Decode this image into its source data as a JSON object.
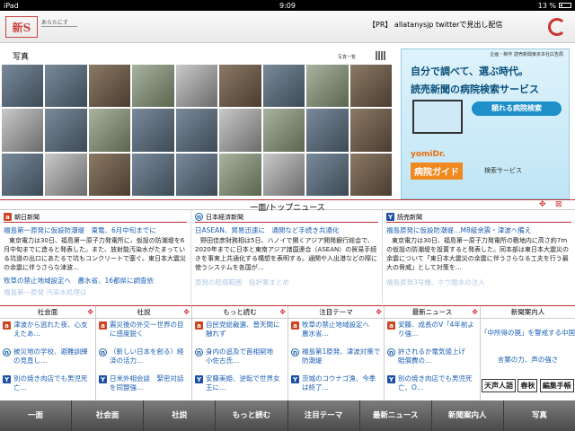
{
  "status": {
    "device": "iPad",
    "time": "9:09",
    "battery": "13 %"
  },
  "header": {
    "logo": "新S",
    "tagline": "あらたにす",
    "pr_text": "【PR】 allatanysjp twitterで見出し配信"
  },
  "photos": {
    "title": "写真",
    "more": "写真一覧"
  },
  "ad": {
    "sponsor": "企画・制作 読売新聞東京本社広告局",
    "headline1": "自分で調べて、選ぶ時代。",
    "headline2": "読売新聞の病院検索サービス",
    "button": "頼れる病院検索",
    "brand": "yomiDr.",
    "guide": "病院ガイド",
    "service": "検索サービス"
  },
  "top_section": {
    "title": "一面/トップニュース",
    "columns": [
      {
        "source": "朝日新聞",
        "icon": "asahi-icon",
        "headline": "福島第一原発に仮設防潮堤　東電、6月中旬までに",
        "body": "東京電力は30日、福島第一原子力発電所に、仮設の防潮堤を6月中旬までに造ると発表した。また、放射能汚染水がたまっている坑道の出口にあたるで坑もコンクリートで塞ぐ。東日本大震災の余震に伴うさらな津波…",
        "link": "牧草の禁止地域設定へ　農水省、16都県に調査依",
        "footer": "福島第一原発 汚染水処理は"
      },
      {
        "source": "日本経済新聞",
        "icon": "nikkei-icon",
        "headline": "日ASEAN、貿易迅速に　通関など手続き共通化",
        "body": "野田佳彦財務相は5日、ハノイで開くアジア開発銀行総会で、2020年までに日本と東南アジア諸国連合（ASEAN）の貿易手続きを事実上共通化する構想を表明する。通関や入出港などの際に使うシステムを各国が…",
        "link": "",
        "footer": "原発の賠償範囲　指針案まとめ"
      },
      {
        "source": "読売新聞",
        "icon": "yomiuri-icon",
        "headline": "福島原発に仮設防潮堤…M8級余震・津波へ備え",
        "body": "東京電力は30日、福島第一原子力発電所の敷地内に高さ約7mの仮設の防潮堤を設置すると発表した。同本部は東日本大震災の余震について「東日本大震災の余震に伴うさらなる工夫を行う最大の脅威」として対策を…",
        "link": "",
        "footer": "福島原発3号機、ホウ酸水の注入"
      }
    ]
  },
  "mini_sections": [
    {
      "title": "社会面",
      "items": [
        {
          "icon": "asahi-icon",
          "text": "津波から逃れた夜、心支えたあ…"
        },
        {
          "icon": "nikkei-icon",
          "text": "被災地の学校、避難訓練の見直し…"
        },
        {
          "icon": "yomiuri-icon",
          "text": "別の焼き肉店でも男児死亡…"
        }
      ]
    },
    {
      "title": "社説",
      "items": [
        {
          "icon": "asahi-icon",
          "text": "震災後の外交一世界の目に感度鋭く"
        },
        {
          "icon": "nikkei-icon",
          "text": "（新しい日本を創る）経済の活力…"
        },
        {
          "icon": "yomiuri-icon",
          "text": "日米外相会談　緊密対話を同盟強…"
        }
      ]
    },
    {
      "title": "もっと読む",
      "items": [
        {
          "icon": "asahi-icon",
          "text": "自民党総裁選、普天間に触れず"
        },
        {
          "icon": "nikkei-icon",
          "text": "身内の追及で首相窮地　小佐古氏…"
        },
        {
          "icon": "yomiuri-icon",
          "text": "安藤美姫、逆転で世界女王に…"
        }
      ]
    },
    {
      "title": "注目テーマ",
      "items": [
        {
          "icon": "asahi-icon",
          "text": "牧草の禁止地域設定へ　農水省…"
        },
        {
          "icon": "nikkei-icon",
          "text": "福島第1原発、津波対策で防潮堤"
        },
        {
          "icon": "yomiuri-icon",
          "text": "茨城のコウナゴ漁、今季は終了…"
        }
      ]
    },
    {
      "title": "最新ニュース",
      "items": [
        {
          "icon": "asahi-icon",
          "text": "安藤、成長のV「4年前より強…"
        },
        {
          "icon": "nikkei-icon",
          "text": "許されるか電気値上げ　賠償費の…"
        },
        {
          "icon": "yomiuri-icon",
          "text": "別の焼き肉店でも男児死亡、O…"
        }
      ]
    }
  ],
  "guide": {
    "title": "新聞案内人",
    "items": [
      "「中所得の罠」を警戒する中国",
      "言葉の力、声の強さ"
    ],
    "logos": [
      "天声人語",
      "春秋",
      "編集手帳"
    ]
  },
  "tabs": [
    "一面",
    "社会面",
    "社説",
    "もっと読む",
    "注目テーマ",
    "最新ニュース",
    "新聞案内人",
    "写真"
  ]
}
